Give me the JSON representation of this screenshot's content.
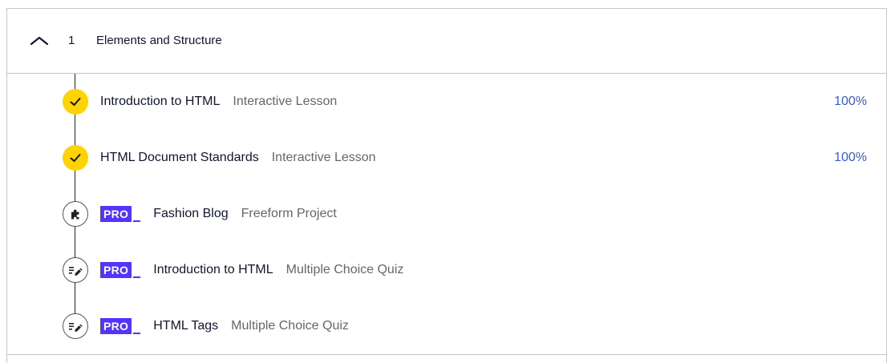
{
  "module": {
    "number": "1",
    "title": "Elements and Structure",
    "expanded": true
  },
  "items": [
    {
      "name": "Introduction to HTML",
      "type": "Interactive Lesson",
      "status": "complete",
      "pro": false,
      "progress": "100%",
      "icon": "check-icon"
    },
    {
      "name": "HTML Document Standards",
      "type": "Interactive Lesson",
      "status": "complete",
      "pro": false,
      "progress": "100%",
      "icon": "check-icon"
    },
    {
      "name": "Fashion Blog",
      "type": "Freeform Project",
      "status": "incomplete",
      "pro": true,
      "pro_label": "PRO",
      "icon": "puzzle-icon"
    },
    {
      "name": "Introduction to HTML",
      "type": "Multiple Choice Quiz",
      "status": "incomplete",
      "pro": true,
      "pro_label": "PRO",
      "icon": "quiz-icon"
    },
    {
      "name": "HTML Tags",
      "type": "Multiple Choice Quiz",
      "status": "incomplete",
      "pro": true,
      "pro_label": "PRO",
      "icon": "quiz-icon"
    }
  ],
  "colors": {
    "complete_badge": "#ffd300",
    "pro_badge": "#5533ff",
    "progress_text": "#3a5bd9",
    "type_text": "#666666"
  }
}
